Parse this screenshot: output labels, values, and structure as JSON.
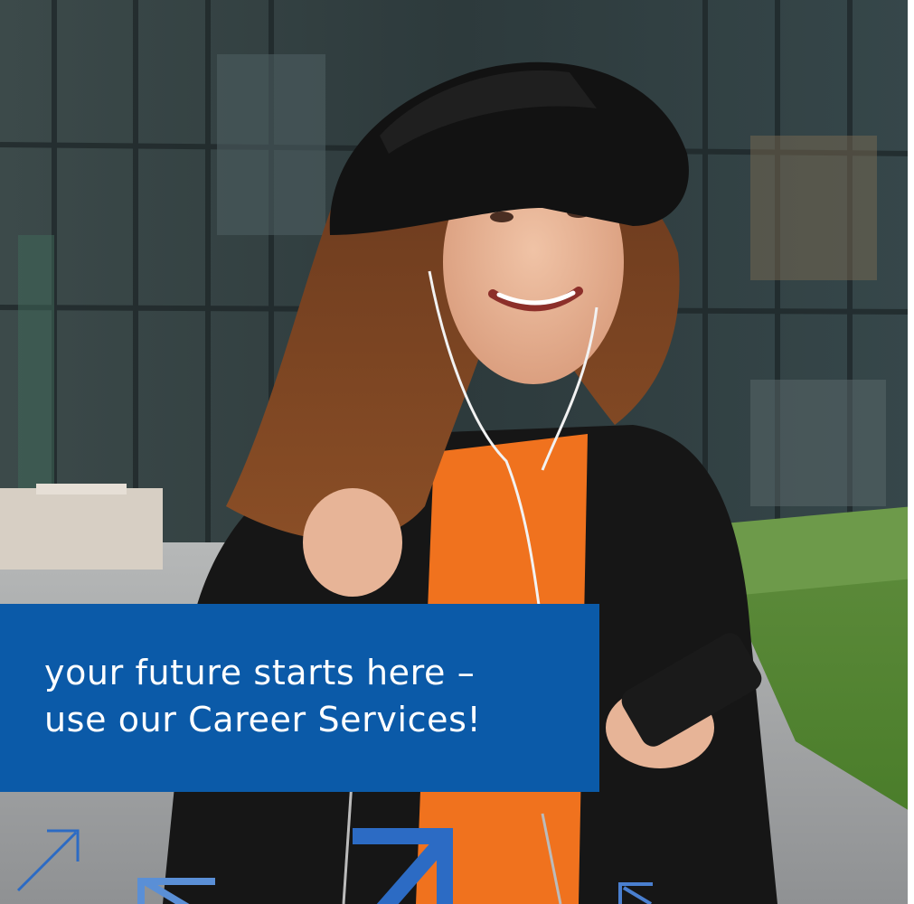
{
  "banner": {
    "line1": "your future starts here –",
    "line2": "use our Career Services!",
    "background_color": "#0b5aa8",
    "text_color": "#ffffff"
  },
  "decor": {
    "arrow_color": "#2c6bc4",
    "arrow_light_color": "#5a8fd6"
  }
}
